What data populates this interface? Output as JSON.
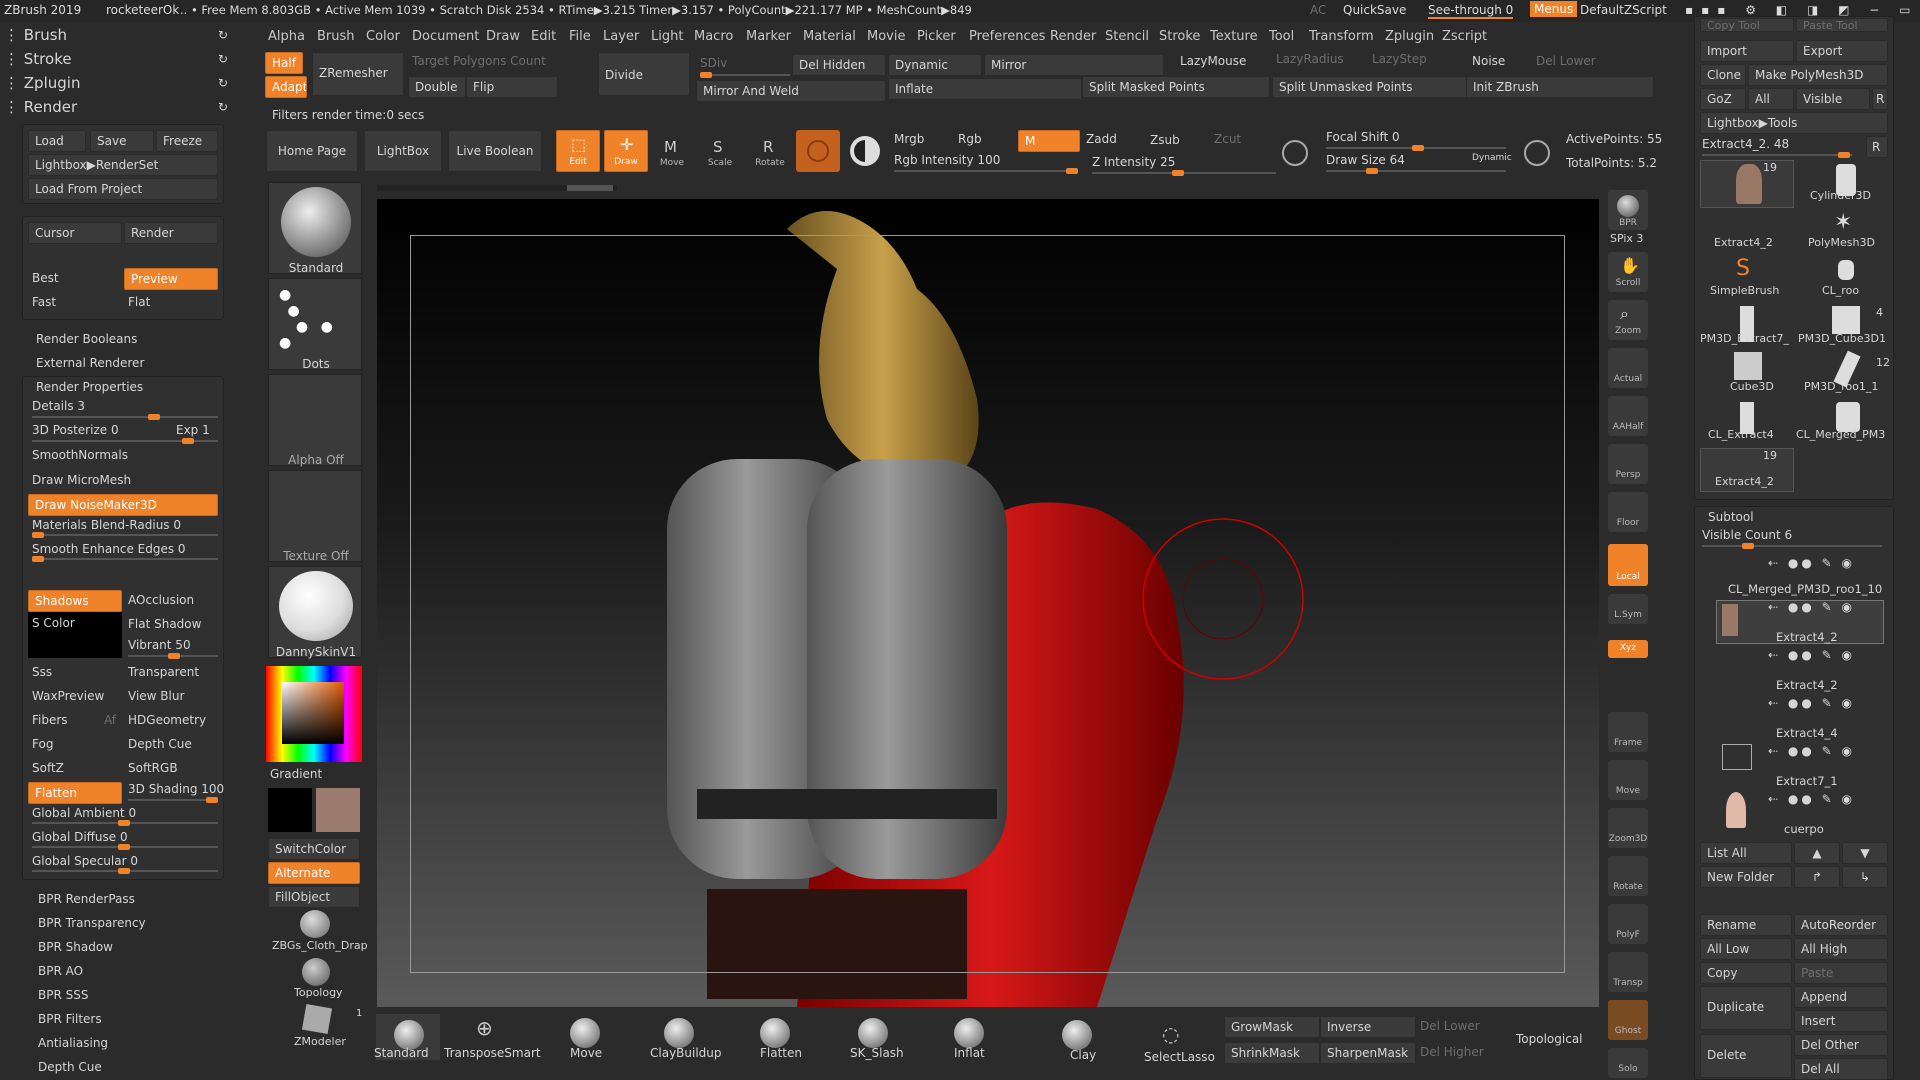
{
  "titlebar": {
    "app": "ZBrush 2019",
    "doc": "rocketeerOk",
    "stats": ".. • Free Mem 8.803GB • Active Mem 1039 • Scratch Disk 2534 • RTime▶3.215 Timer▶3.157 • PolyCount▶221.177 MP • MeshCount▶849",
    "ac": "AC",
    "quicksave": "QuickSave",
    "seethrough": "See-through  0",
    "menus": "Menus",
    "script": "DefaultZScript"
  },
  "top_left": {
    "brush": "Brush",
    "stroke": "Stroke",
    "zplugin": "Zplugin",
    "render": "Render"
  },
  "menu": [
    "Alpha",
    "Brush",
    "Color",
    "Document",
    "Draw",
    "Edit",
    "File",
    "Layer",
    "Light",
    "Macro",
    "Marker",
    "Material",
    "Movie",
    "Picker",
    "Preferences",
    "Render",
    "Stencil",
    "Stroke",
    "Texture",
    "Tool",
    "Transform",
    "Zplugin",
    "Zscript"
  ],
  "toolbar1": {
    "half": "Half",
    "adapt": "Adapt",
    "zremesher": "ZRemesher",
    "target": "Target Polygons Count",
    "double": "Double",
    "flip": "Flip",
    "divide": "Divide",
    "sdiv": "SDiv",
    "delhidden": "Del Hidden",
    "mirrorweld": "Mirror And Weld",
    "dynamic": "Dynamic",
    "mirror": "Mirror",
    "inflate": "Inflate",
    "lazymouse": "LazyMouse",
    "lazyradius": "LazyRadius",
    "lazystep": "LazyStep",
    "noise": "Noise",
    "dellower": "Del Lower",
    "splitmasked": "Split Masked Points",
    "splitunmasked": "Split Unmasked Points",
    "initz": "Init ZBrush"
  },
  "filters_msg": "Filters render time:0 secs",
  "toolbar2": {
    "home": "Home Page",
    "lightbox": "LightBox",
    "liveboolean": "Live Boolean",
    "edit": "Edit",
    "draw": "Draw",
    "move": "Move",
    "scale": "Scale",
    "rotate": "Rotate",
    "mrgb": "Mrgb",
    "rgb": "Rgb",
    "m": "M",
    "zadd": "Zadd",
    "zsub": "Zsub",
    "zcut": "Zcut",
    "rgb_intensity": "Rgb Intensity 100",
    "z_intensity": "Z Intensity 25",
    "focal": "Focal Shift 0",
    "drawsize": "Draw Size 64",
    "dynamic": "Dynamic",
    "active_points": "ActivePoints: 55",
    "total_points": "TotalPoints: 5.2"
  },
  "left": {
    "load": "Load",
    "save": "Save",
    "freeze": "Freeze",
    "lightbox_renderset": "Lightbox▶RenderSet",
    "load_project": "Load From Project",
    "cursor": "Cursor",
    "render": "Render",
    "best": "Best",
    "preview": "Preview",
    "fast": "Fast",
    "flat": "Flat",
    "render_booleans": "Render Booleans",
    "external_renderer": "External Renderer",
    "render_properties": "Render Properties",
    "details": "Details 3",
    "posterize": "3D Posterize 0",
    "exp": "Exp 1",
    "smoothnormals": "SmoothNormals",
    "micromesh": "Draw MicroMesh",
    "noisemaker": "Draw NoiseMaker3D",
    "blendradius": "Materials Blend-Radius 0",
    "smoothedges": "Smooth Enhance Edges 0",
    "shadows": "Shadows",
    "aocclusion": "AOcclusion",
    "scolor": "S Color",
    "flatshadow": "Flat Shadow",
    "vibrant": "Vibrant 50",
    "sss": "Sss",
    "transparent": "Transparent",
    "waxpreview": "WaxPreview",
    "viewblur": "View Blur",
    "fibers": "Fibers",
    "af": "Af",
    "hdgeometry": "HDGeometry",
    "fog": "Fog",
    "depthcue": "Depth Cue",
    "softz": "SoftZ",
    "softrgb": "SoftRGB",
    "flatten": "Flatten",
    "shading": "3D Shading 100",
    "ambient": "Global Ambient 0",
    "diffuse": "Global Diffuse 0",
    "specular": "Global Specular 0",
    "bpr": [
      "BPR RenderPass",
      "BPR Transparency",
      "BPR Shadow",
      "BPR AO",
      "BPR SSS",
      "BPR Filters",
      "Antialiasing",
      "Depth Cue"
    ]
  },
  "shelf": {
    "standard": "Standard",
    "dots": "Dots",
    "alpha_off": "Alpha Off",
    "texture_off": "Texture Off",
    "material": "DannySkinV1",
    "gradient": "Gradient",
    "switchcolor": "SwitchColor",
    "alternate": "Alternate",
    "fillobject": "FillObject",
    "cloth": "ZBGs_Cloth_Drap",
    "topology": "Topology",
    "zmodeler": "ZModeler",
    "zmodeler_count": "1"
  },
  "bottom": {
    "brushes": [
      "Standard",
      "TransposeSmart",
      "Move",
      "ClayBuildup",
      "Flatten",
      "SK_Slash",
      "Inflat",
      "Clay",
      "SelectLasso"
    ],
    "growmask": "GrowMask",
    "inverse": "Inverse",
    "dellower": "Del Lower",
    "shrinkmask": "ShrinkMask",
    "sharpenmask": "SharpenMask",
    "delhigher": "Del Higher",
    "topological": "Topological"
  },
  "right_strip": [
    "BPR",
    "SPix 3",
    "Scroll",
    "Zoom",
    "Actual",
    "AAHalf",
    "Persp",
    "Floor",
    "Local",
    "L.Sym",
    "Xyz",
    "Frame",
    "Move",
    "Zoom3D",
    "Rotate",
    "PolyF",
    "Transp",
    "Ghost",
    "Solo"
  ],
  "right": {
    "copytool": "Copy Tool",
    "pastetool": "Paste Tool",
    "import": "Import",
    "export": "Export",
    "clone": "Clone",
    "makepoly": "Make PolyMesh3D",
    "goz": "GoZ",
    "all": "All",
    "visible": "Visible",
    "r": "R",
    "lightbox_tools": "Lightbox▶Tools",
    "current": "Extract4_2. 48",
    "tools": [
      {
        "name": "Extract4_2",
        "count": "19"
      },
      {
        "name": "Cylinder3D",
        "count": ""
      },
      {
        "name": "PolyMesh3D",
        "count": ""
      },
      {
        "name": "SimpleBrush",
        "count": ""
      },
      {
        "name": "CL_roo",
        "count": ""
      },
      {
        "name": "PM3D_Extract7_",
        "count": ""
      },
      {
        "name": "PM3D_Cube3D1",
        "count": "4"
      },
      {
        "name": "Cube3D",
        "count": ""
      },
      {
        "name": "PM3D_roo1_1",
        "count": "12"
      },
      {
        "name": "CL_Extract4",
        "count": ""
      },
      {
        "name": "CL_Merged_PM3",
        "count": ""
      },
      {
        "name": "Extract4_2",
        "count": "19"
      }
    ],
    "subtool": "Subtool",
    "visiblecount": "Visible Count 6",
    "subtools": [
      "CL_Merged_PM3D_roo1_10",
      "Extract4_2",
      "Extract4_2",
      "Extract4_4",
      "Extract7_1",
      "cuerpo"
    ],
    "listall": "List All",
    "newfolder": "New Folder",
    "rename": "Rename",
    "autoreorder": "AutoReorder",
    "alllow": "All Low",
    "allhigh": "All High",
    "copy": "Copy",
    "paste": "Paste",
    "append": "Append",
    "duplicate": "Duplicate",
    "insert": "Insert",
    "delete": "Delete",
    "delother": "Del Other",
    "delall": "Del All"
  },
  "colors": {
    "accent": "#f0822a",
    "panel": "#303030",
    "bg": "#2b2b2b"
  }
}
